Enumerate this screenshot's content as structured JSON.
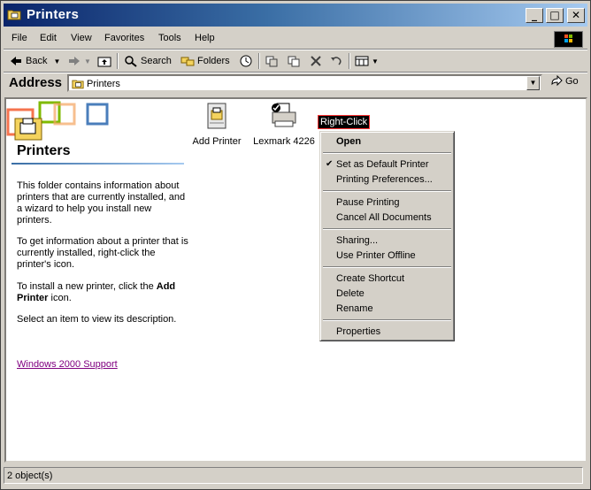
{
  "window": {
    "title": "Printers"
  },
  "menubar": {
    "items": [
      "File",
      "Edit",
      "View",
      "Favorites",
      "Tools",
      "Help"
    ]
  },
  "toolbar": {
    "back": "Back",
    "search": "Search",
    "folders": "Folders"
  },
  "address": {
    "label": "Address",
    "value": "Printers",
    "go": "Go"
  },
  "panel": {
    "title": "Printers",
    "para1": "This folder contains information about printers that are currently installed, and a wizard to help you install new printers.",
    "para2": "To get information about a printer that is currently installed, right-click the printer's icon.",
    "para3_prefix": "To install a new printer, click the ",
    "para3_bold": "Add Printer",
    "para3_suffix": " icon.",
    "para4": "Select an item to view its description.",
    "support_link": "Windows 2000 Support"
  },
  "items": [
    {
      "label": "Add Printer",
      "icon": "add-printer-icon"
    },
    {
      "label": "Lexmark 4226",
      "icon": "default-printer-icon"
    }
  ],
  "callout": "Right-Click",
  "context_menu": {
    "open": "Open",
    "set_default": "Set as Default Printer",
    "prefs": "Printing Preferences...",
    "pause": "Pause Printing",
    "cancel_all": "Cancel All Documents",
    "sharing": "Sharing...",
    "offline": "Use Printer Offline",
    "shortcut": "Create Shortcut",
    "delete": "Delete",
    "rename": "Rename",
    "properties": "Properties"
  },
  "statusbar": {
    "text": "2 object(s)"
  },
  "colors": {
    "title_start": "#0a246a",
    "title_end": "#a6caf0",
    "link_visited": "#800080",
    "callout_border": "#ff3333"
  }
}
